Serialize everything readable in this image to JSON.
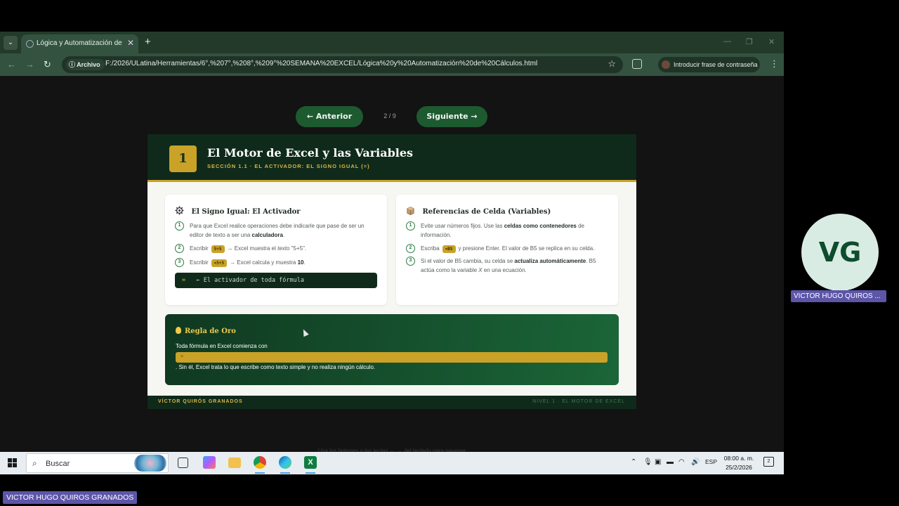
{
  "browser": {
    "tab_title": "Lógica y Automatización de Cálculos",
    "new_tab_symbol": "+",
    "tab_close_symbol": "✕",
    "site_chip": "Archivo",
    "url": "F:/2026/ULatina/Herramientas/6°,%207°,%208°,%209°%20SEMANA%20EXCEL/Lógica%20y%20Automatización%20de%20Cálculos.html",
    "passphrase_button": "Introducir frase de contraseña"
  },
  "slide_nav": {
    "prev_label": "← Anterior",
    "next_label": "Siguiente →",
    "page_indicator": "2 / 9"
  },
  "slide": {
    "number": "1",
    "title": "El Motor de Excel y las Variables",
    "subtitle": "SECCIÓN 1.1 · EL ACTIVADOR: EL SIGNO IGUAL (=)",
    "card_left": {
      "icon": "gear-icon",
      "title": "El Signo Igual: El Activador",
      "items": [
        {
          "num": "1",
          "pre": "Para que Excel realice operaciones debe indicarle que pase de ser un editor de texto a ser una ",
          "bold": "calculadora",
          "post": "."
        },
        {
          "num": "2",
          "pre": "Escribir",
          "chip": "5+5",
          "mid": "→ Excel muestra el ",
          "em": "texto",
          "post": " \"5+5\"."
        },
        {
          "num": "3",
          "pre": "Escribir",
          "chip": "=5+5",
          "mid": "→ Excel calcula y muestra ",
          "bold": "10",
          "post": "."
        }
      ],
      "code_eq": "=",
      "code_comment": "   ← El activador de toda fórmula"
    },
    "card_right": {
      "icon": "box-icon",
      "title": "Referencias de Celda (Variables)",
      "items": [
        {
          "num": "1",
          "pre": "Evite usar números fijos. Use las ",
          "bold": "celdas como contenedores",
          "post": " de información."
        },
        {
          "num": "2",
          "pre": "Escriba",
          "chip": "=B5",
          "post": "y presione Enter. El valor de B5 se replica en su celda."
        },
        {
          "num": "3",
          "pre": "Si el valor de B5 cambia, su celda se ",
          "bold": "actualiza automáticamente",
          "mid": ". B5 actúa como la variable ",
          "em": "X",
          "post": " en una ecuación."
        }
      ]
    },
    "rule": {
      "title": "Regla de Oro",
      "text1": "Toda fórmula en Excel comienza con",
      "bar_value": "=",
      "text2": ". Sin él, Excel trata lo que escribe como texto simple y no realiza ningún cálculo."
    },
    "footer_left": "VÍCTOR QUIRÓS GRANADOS",
    "footer_right": "NIVEL 1 · EL MOTOR DE EXCEL"
  },
  "hint": "Usa los botones o las teclas ← → del teclado para navegar",
  "taskbar": {
    "search_placeholder": "Buscar",
    "language": "ESP",
    "time": "08:00 a. m.",
    "date": "25/2/2026",
    "notifications": "2"
  },
  "participant": {
    "initials": "VG",
    "tile_name": "VICTOR HUGO QUIROS ...",
    "presenter_name": "VICTOR HUGO QUIROS GRANADOS"
  },
  "colors": {
    "accent_green": "#1d5a30",
    "dark_green": "#0f2a1a",
    "gold": "#c9a227",
    "participant_badge": "#5c55a8"
  }
}
